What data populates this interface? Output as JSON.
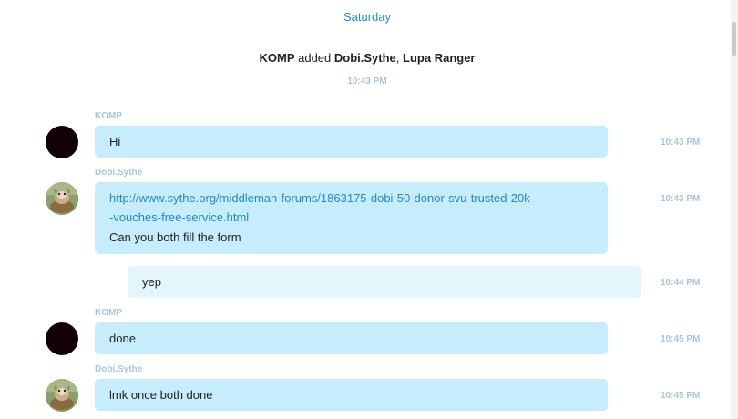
{
  "day_separator": "Saturday",
  "system_message": {
    "actor": "KOMP",
    "verb": "added",
    "targets": "Dobi.Sythe",
    "separator": ", ",
    "targets_2": "Lupa Ranger",
    "time": "10:43 PM"
  },
  "messages": [
    {
      "sender": "KOMP",
      "text": "Hi",
      "time": "10:43 PM",
      "avatar": "dark-avatar"
    },
    {
      "sender": "Dobi.Sythe",
      "link_line1": "http://www.sythe.org/middleman-forums/1863175-dobi-50-donor-svu-trusted-20k",
      "link_line2": "-vouches-free-service.html",
      "text": "Can you both fill the form",
      "time": "10:43 PM",
      "avatar": "hamster-photo-avatar"
    },
    {
      "sender": "",
      "text": "yep",
      "time": "10:44 PM",
      "own": true
    },
    {
      "sender": "KOMP",
      "text": "done",
      "time": "10:45 PM",
      "avatar": "dark-avatar"
    },
    {
      "sender": "Dobi.Sythe",
      "text": "lmk once both done",
      "time": "10:45 PM",
      "avatar": "hamster-photo-avatar"
    }
  ],
  "colors": {
    "incoming_bubble": "#c7ecfc",
    "own_bubble": "#e5f5fc",
    "link": "#2389c0",
    "timestamp": "#a9c6d6",
    "day_label": "#2a8fbf"
  }
}
